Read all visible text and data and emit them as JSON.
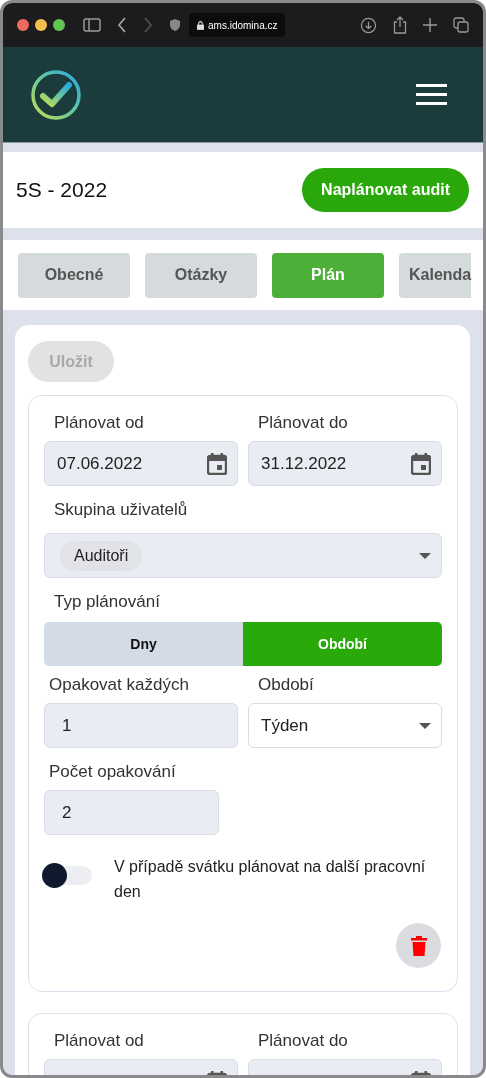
{
  "browser": {
    "url": "ams.idomina.cz"
  },
  "title": "5S - 2022",
  "primary_button": "Naplánovat audit",
  "tabs": [
    {
      "label": "Obecné",
      "selected": false
    },
    {
      "label": "Otázky",
      "selected": false
    },
    {
      "label": "Plán",
      "selected": true
    },
    {
      "label": "Kalenda",
      "selected": false
    }
  ],
  "save_button": {
    "label": "Uložit",
    "disabled": true
  },
  "plans": [
    {
      "from": {
        "label": "Plánovat od",
        "value": "07.06.2022"
      },
      "to": {
        "label": "Plánovat do",
        "value": "31.12.2022"
      },
      "group": {
        "label": "Skupina uživatelů",
        "chips": [
          "Auditoři"
        ]
      },
      "type": {
        "label": "Typ plánování",
        "options": [
          {
            "label": "Dny",
            "selected": false
          },
          {
            "label": "Období",
            "selected": true
          }
        ]
      },
      "repeat_every": {
        "label": "Opakovat každých",
        "value": "1"
      },
      "period": {
        "label": "Období",
        "value": "Týden"
      },
      "count": {
        "label": "Počet opakování",
        "value": "2"
      },
      "holiday": {
        "label": "V případě svátku plánovat na další pracovní den",
        "on": false
      }
    },
    {
      "from": {
        "label": "Plánovat od"
      },
      "to": {
        "label": "Plánovat do"
      }
    }
  ]
}
